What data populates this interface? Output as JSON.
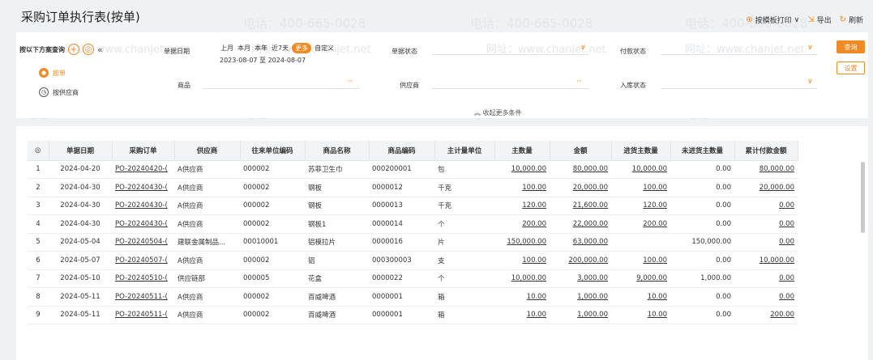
{
  "watermark": {
    "phone": "电话：400-665-0028",
    "site": "网址：www.chanjet.net"
  },
  "header": {
    "title": "采购订单执行表(按单)",
    "actions": [
      {
        "label": "按模板打印",
        "icon": "print-icon"
      },
      {
        "label": "导出",
        "icon": "export-icon"
      },
      {
        "label": "刷新",
        "icon": "refresh-icon"
      }
    ]
  },
  "filter": {
    "scheme_label": "按以下方案查询",
    "views": [
      "按单",
      "按供应商"
    ],
    "date_label": "单据日期",
    "quick_dates": [
      "上月",
      "本月",
      "本年",
      "近7天",
      "更多",
      "自定义"
    ],
    "date_range": "2023-08-07 至 2024-08-07",
    "doc_status_label": "单据状态",
    "pay_status_label": "付款状态",
    "product_label": "商品",
    "supplier_label": "供应商",
    "inbound_status_label": "入库状态",
    "query_btn": "查询",
    "settings_btn": "设置",
    "collapse_label": "收起更多条件"
  },
  "table": {
    "columns": [
      "单据日期",
      "采购订单",
      "供应商",
      "往来单位编码",
      "商品名称",
      "商品编码",
      "主计量单位",
      "主数量",
      "金额",
      "进货主数量",
      "未进货主数量",
      "累计付款金额"
    ],
    "rows": [
      [
        "1",
        "2024-04-20",
        "PO-20240420-(",
        "A供应商",
        "000002",
        "苏菲卫生巾",
        "000200001",
        "包",
        "10,000.00",
        "80,000.00",
        "10,000.00",
        "0.00",
        "80,000.00"
      ],
      [
        "2",
        "2024-04-30",
        "PO-20240430-(",
        "A供应商",
        "000002",
        "钢板",
        "0000012",
        "千克",
        "100.00",
        "20,000.00",
        "100.00",
        "0.00",
        "20,000.00"
      ],
      [
        "3",
        "2024-04-30",
        "PO-20240430-(",
        "A供应商",
        "000002",
        "钢板",
        "0000013",
        "千克",
        "120.00",
        "21,600.00",
        "120.00",
        "0.00",
        "0.00"
      ],
      [
        "4",
        "2024-04-30",
        "PO-20240430-(",
        "A供应商",
        "000002",
        "钢板1",
        "0000014",
        "个",
        "200.00",
        "22,000.00",
        "200.00",
        "0.00",
        "0.00"
      ],
      [
        "5",
        "2024-05-04",
        "PO-20240504-(",
        "建联金属制品...",
        "00010001",
        "铝模拉片",
        "0000016",
        "片",
        "150,000.00",
        "63,000.00",
        "",
        "150,000.00",
        "0.00"
      ],
      [
        "6",
        "2024-05-07",
        "PO-20240507-(",
        "A供应商",
        "000002",
        "铝",
        "000300003",
        "支",
        "100.00",
        "200,000.00",
        "100.00",
        "0.00",
        "10,000.00"
      ],
      [
        "7",
        "2024-05-10",
        "PO-20240510-(",
        "供应链部",
        "000005",
        "花盒",
        "0000022",
        "个",
        "10,000.00",
        "3,000.00",
        "9,000.00",
        "1,000.00",
        "0.00"
      ],
      [
        "8",
        "2024-05-11",
        "PO-20240511-(",
        "A供应商",
        "000002",
        "百威啤酒",
        "0000001",
        "箱",
        "10.00",
        "1,000.00",
        "10.00",
        "0.00",
        "0.00"
      ],
      [
        "9",
        "2024-05-11",
        "PO-20240511-(",
        "A供应商",
        "000002",
        "百威啤酒",
        "0000001",
        "箱",
        "10.00",
        "1,000.00",
        "10.00",
        "0.00",
        "200.00"
      ]
    ]
  }
}
